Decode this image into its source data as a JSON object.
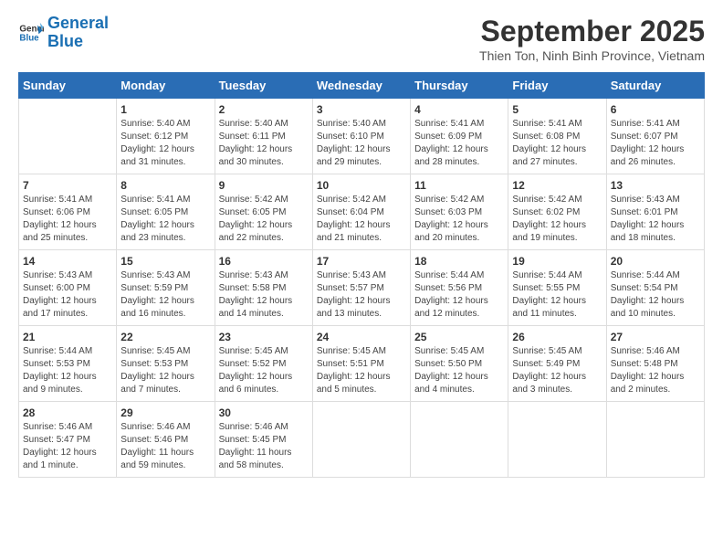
{
  "header": {
    "logo_line1": "General",
    "logo_line2": "Blue",
    "month": "September 2025",
    "location": "Thien Ton, Ninh Binh Province, Vietnam"
  },
  "weekdays": [
    "Sunday",
    "Monday",
    "Tuesday",
    "Wednesday",
    "Thursday",
    "Friday",
    "Saturday"
  ],
  "weeks": [
    [
      {
        "day": "",
        "info": ""
      },
      {
        "day": "1",
        "info": "Sunrise: 5:40 AM\nSunset: 6:12 PM\nDaylight: 12 hours\nand 31 minutes."
      },
      {
        "day": "2",
        "info": "Sunrise: 5:40 AM\nSunset: 6:11 PM\nDaylight: 12 hours\nand 30 minutes."
      },
      {
        "day": "3",
        "info": "Sunrise: 5:40 AM\nSunset: 6:10 PM\nDaylight: 12 hours\nand 29 minutes."
      },
      {
        "day": "4",
        "info": "Sunrise: 5:41 AM\nSunset: 6:09 PM\nDaylight: 12 hours\nand 28 minutes."
      },
      {
        "day": "5",
        "info": "Sunrise: 5:41 AM\nSunset: 6:08 PM\nDaylight: 12 hours\nand 27 minutes."
      },
      {
        "day": "6",
        "info": "Sunrise: 5:41 AM\nSunset: 6:07 PM\nDaylight: 12 hours\nand 26 minutes."
      }
    ],
    [
      {
        "day": "7",
        "info": "Sunrise: 5:41 AM\nSunset: 6:06 PM\nDaylight: 12 hours\nand 25 minutes."
      },
      {
        "day": "8",
        "info": "Sunrise: 5:41 AM\nSunset: 6:05 PM\nDaylight: 12 hours\nand 23 minutes."
      },
      {
        "day": "9",
        "info": "Sunrise: 5:42 AM\nSunset: 6:05 PM\nDaylight: 12 hours\nand 22 minutes."
      },
      {
        "day": "10",
        "info": "Sunrise: 5:42 AM\nSunset: 6:04 PM\nDaylight: 12 hours\nand 21 minutes."
      },
      {
        "day": "11",
        "info": "Sunrise: 5:42 AM\nSunset: 6:03 PM\nDaylight: 12 hours\nand 20 minutes."
      },
      {
        "day": "12",
        "info": "Sunrise: 5:42 AM\nSunset: 6:02 PM\nDaylight: 12 hours\nand 19 minutes."
      },
      {
        "day": "13",
        "info": "Sunrise: 5:43 AM\nSunset: 6:01 PM\nDaylight: 12 hours\nand 18 minutes."
      }
    ],
    [
      {
        "day": "14",
        "info": "Sunrise: 5:43 AM\nSunset: 6:00 PM\nDaylight: 12 hours\nand 17 minutes."
      },
      {
        "day": "15",
        "info": "Sunrise: 5:43 AM\nSunset: 5:59 PM\nDaylight: 12 hours\nand 16 minutes."
      },
      {
        "day": "16",
        "info": "Sunrise: 5:43 AM\nSunset: 5:58 PM\nDaylight: 12 hours\nand 14 minutes."
      },
      {
        "day": "17",
        "info": "Sunrise: 5:43 AM\nSunset: 5:57 PM\nDaylight: 12 hours\nand 13 minutes."
      },
      {
        "day": "18",
        "info": "Sunrise: 5:44 AM\nSunset: 5:56 PM\nDaylight: 12 hours\nand 12 minutes."
      },
      {
        "day": "19",
        "info": "Sunrise: 5:44 AM\nSunset: 5:55 PM\nDaylight: 12 hours\nand 11 minutes."
      },
      {
        "day": "20",
        "info": "Sunrise: 5:44 AM\nSunset: 5:54 PM\nDaylight: 12 hours\nand 10 minutes."
      }
    ],
    [
      {
        "day": "21",
        "info": "Sunrise: 5:44 AM\nSunset: 5:53 PM\nDaylight: 12 hours\nand 9 minutes."
      },
      {
        "day": "22",
        "info": "Sunrise: 5:45 AM\nSunset: 5:53 PM\nDaylight: 12 hours\nand 7 minutes."
      },
      {
        "day": "23",
        "info": "Sunrise: 5:45 AM\nSunset: 5:52 PM\nDaylight: 12 hours\nand 6 minutes."
      },
      {
        "day": "24",
        "info": "Sunrise: 5:45 AM\nSunset: 5:51 PM\nDaylight: 12 hours\nand 5 minutes."
      },
      {
        "day": "25",
        "info": "Sunrise: 5:45 AM\nSunset: 5:50 PM\nDaylight: 12 hours\nand 4 minutes."
      },
      {
        "day": "26",
        "info": "Sunrise: 5:45 AM\nSunset: 5:49 PM\nDaylight: 12 hours\nand 3 minutes."
      },
      {
        "day": "27",
        "info": "Sunrise: 5:46 AM\nSunset: 5:48 PM\nDaylight: 12 hours\nand 2 minutes."
      }
    ],
    [
      {
        "day": "28",
        "info": "Sunrise: 5:46 AM\nSunset: 5:47 PM\nDaylight: 12 hours\nand 1 minute."
      },
      {
        "day": "29",
        "info": "Sunrise: 5:46 AM\nSunset: 5:46 PM\nDaylight: 11 hours\nand 59 minutes."
      },
      {
        "day": "30",
        "info": "Sunrise: 5:46 AM\nSunset: 5:45 PM\nDaylight: 11 hours\nand 58 minutes."
      },
      {
        "day": "",
        "info": ""
      },
      {
        "day": "",
        "info": ""
      },
      {
        "day": "",
        "info": ""
      },
      {
        "day": "",
        "info": ""
      }
    ]
  ]
}
